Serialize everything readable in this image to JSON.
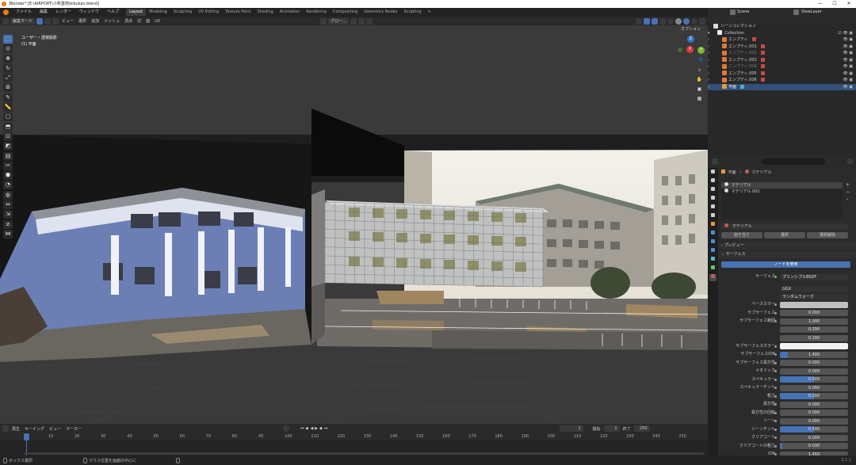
{
  "titlebar": {
    "title": "Blender* [E:\\AIRPORT\\小牧基地\\kikukan.blend]",
    "min": "—",
    "max": "☐",
    "close": "✕"
  },
  "menu": [
    "ファイル",
    "編集",
    "レンダー",
    "ウィンドウ",
    "ヘルプ"
  ],
  "workspaces": [
    {
      "label": "Layout",
      "active": true
    },
    {
      "label": "Modeling",
      "active": false
    },
    {
      "label": "Sculpting",
      "active": false
    },
    {
      "label": "UV Editing",
      "active": false
    },
    {
      "label": "Texture Paint",
      "active": false
    },
    {
      "label": "Shading",
      "active": false
    },
    {
      "label": "Animation",
      "active": false
    },
    {
      "label": "Rendering",
      "active": false
    },
    {
      "label": "Compositing",
      "active": false
    },
    {
      "label": "Geometry Nodes",
      "active": false
    },
    {
      "label": "Scripting",
      "active": false
    }
  ],
  "add_workspace": "+",
  "scene": {
    "label": "Scene",
    "viewlayer": "ViewLayer"
  },
  "viewport_header": {
    "mode": "編集モード",
    "menus": [
      "ビュー",
      "選択",
      "追加",
      "メッシュ",
      "頂点",
      "辺",
      "面",
      "UV"
    ],
    "transform": "グロー...",
    "options": "オプション"
  },
  "viewport_info": {
    "view": "ユーザー・透視投影",
    "object": "(1) 平面"
  },
  "gizmo": {
    "x": "X",
    "y": "Y",
    "z": "Z"
  },
  "tools": [
    "select",
    "cursor",
    "move",
    "rotate",
    "scale",
    "transform",
    "annotate",
    "measure",
    "add-cube",
    "extrude",
    "inset",
    "bevel",
    "loop-cut",
    "knife",
    "poly-build",
    "spin",
    "smooth",
    "edge-slide",
    "shrink",
    "shear",
    "rip"
  ],
  "timeline": {
    "menus": [
      "再生",
      "キーイング",
      "ビュー",
      "マーカー"
    ],
    "current_frame": "1",
    "start_label": "開始",
    "start": "1",
    "end_label": "終了",
    "end": "250",
    "ticks": [
      "1",
      "10",
      "20",
      "30",
      "40",
      "50",
      "60",
      "70",
      "80",
      "90",
      "100",
      "110",
      "120",
      "130",
      "140",
      "150",
      "160",
      "170",
      "180",
      "190",
      "200",
      "210",
      "220",
      "230",
      "240",
      "250"
    ]
  },
  "status": {
    "left": "ボックス選択",
    "middle": "マウス位置を画面の中心に",
    "right": "3.1.2"
  },
  "outliner": {
    "root": "シーンコレクション",
    "collection": "Collection",
    "items": [
      {
        "name": "エンプティ",
        "dim": false,
        "sel": false
      },
      {
        "name": "エンプティ.001",
        "dim": false,
        "sel": false
      },
      {
        "name": "エンプティ.002",
        "dim": true,
        "sel": false
      },
      {
        "name": "エンプティ.003",
        "dim": false,
        "sel": false
      },
      {
        "name": "エンプティ.004",
        "dim": true,
        "sel": false
      },
      {
        "name": "エンプティ.005",
        "dim": false,
        "sel": false
      },
      {
        "name": "エンプティ.006",
        "dim": false,
        "sel": false
      },
      {
        "name": "平面",
        "dim": false,
        "sel": true
      }
    ]
  },
  "properties": {
    "breadcrumb_obj": "平面",
    "breadcrumb_mat": "マテリアル",
    "slots": [
      "マテリアル",
      "マテリアル.001"
    ],
    "material_name": "マテリアル",
    "assign": "割り当て",
    "select": "選択",
    "deselect": "選択解除",
    "preview": "プレビュー",
    "surface_panel": "サーフェス",
    "use_nodes": "ノードを使用",
    "surface_label": "サーフェス",
    "surface_value": "プリンシプルBSDF",
    "distribution": "GGX",
    "subsurface_method": "ランダムウォーク",
    "rows": [
      {
        "label": "ベースカラー",
        "value": "",
        "kind": "color"
      },
      {
        "label": "サブサーフェス",
        "value": "0.000",
        "kind": "num",
        "fill": 0
      },
      {
        "label": "サブサーフェス範囲",
        "value": "1.000",
        "kind": "num",
        "fill": 0
      },
      {
        "label": "",
        "value": "0.200",
        "kind": "num",
        "fill": 0
      },
      {
        "label": "",
        "value": "0.100",
        "kind": "num",
        "fill": 0
      },
      {
        "label": "サブサーフェスカラー",
        "value": "",
        "kind": "colorw"
      },
      {
        "label": "サブサーフェスIOR",
        "value": "1.400",
        "kind": "num",
        "fill": 0.12
      },
      {
        "label": "サブサーフェス異方性",
        "value": "0.000",
        "kind": "num",
        "fill": 0
      },
      {
        "label": "メタリック",
        "value": "0.000",
        "kind": "num",
        "fill": 0
      },
      {
        "label": "スペキュラー",
        "value": "0.500",
        "kind": "num",
        "fill": 0.5
      },
      {
        "label": "スペキュラーチント",
        "value": "0.000",
        "kind": "num",
        "fill": 0
      },
      {
        "label": "粗さ",
        "value": "0.500",
        "kind": "num",
        "fill": 0.5
      },
      {
        "label": "異方性",
        "value": "0.000",
        "kind": "num",
        "fill": 0
      },
      {
        "label": "異方性の回転",
        "value": "0.000",
        "kind": "num",
        "fill": 0
      },
      {
        "label": "シーン",
        "value": "0.000",
        "kind": "num",
        "fill": 0
      },
      {
        "label": "シーンチント",
        "value": "0.500",
        "kind": "num",
        "fill": 0.5
      },
      {
        "label": "クリアコート",
        "value": "0.000",
        "kind": "num",
        "fill": 0
      },
      {
        "label": "クリアコートの粗さ",
        "value": "0.030",
        "kind": "num",
        "fill": 0.03
      },
      {
        "label": "IOR",
        "value": "1.450",
        "kind": "num",
        "fill": 0
      }
    ]
  }
}
